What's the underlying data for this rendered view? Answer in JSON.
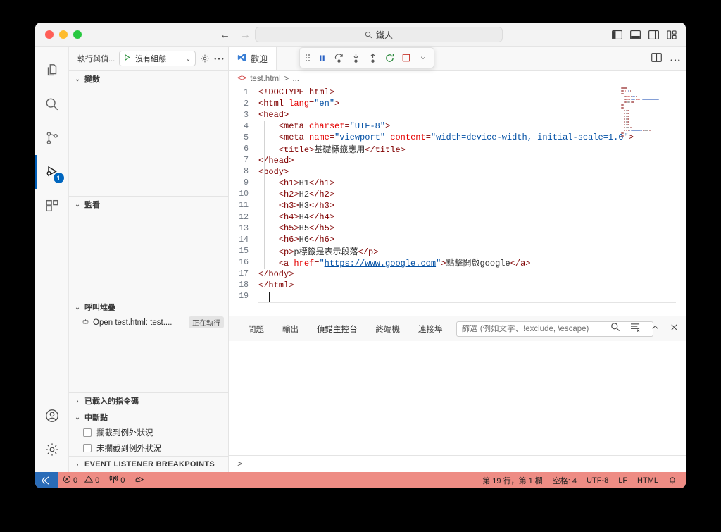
{
  "window": {
    "traffic_lights": [
      "close",
      "minimize",
      "maximize"
    ],
    "command_center_value": "鐵人",
    "nav_back": "←",
    "nav_forward": "→"
  },
  "activitybar": {
    "items": [
      {
        "name": "explorer",
        "icon": "files-icon",
        "active": false
      },
      {
        "name": "search",
        "icon": "search-icon",
        "active": false
      },
      {
        "name": "source-control",
        "icon": "source-control-icon",
        "active": false
      },
      {
        "name": "run-and-debug",
        "icon": "run-debug-icon",
        "active": true,
        "badge": "1"
      },
      {
        "name": "extensions",
        "icon": "extensions-icon",
        "active": false
      }
    ],
    "bottom": [
      {
        "name": "account",
        "icon": "account-icon"
      },
      {
        "name": "manage",
        "icon": "gear-icon"
      }
    ]
  },
  "sidebar": {
    "title": "執行與偵...",
    "launch_config": "沒有組態",
    "start_debug_label": "▷",
    "panes": [
      {
        "id": "variables",
        "label": "變數",
        "expanded": true
      },
      {
        "id": "watch",
        "label": "監看",
        "expanded": true
      },
      {
        "id": "callstack",
        "label": "呼叫堆疊",
        "expanded": true
      },
      {
        "id": "loaded_scripts",
        "label": "已載入的指令碼",
        "expanded": false
      },
      {
        "id": "breakpoints",
        "label": "中斷點",
        "expanded": true
      },
      {
        "id": "event_listener_breakpoints",
        "label": "EVENT LISTENER BREAKPOINTS",
        "expanded": false
      }
    ],
    "callstack_rows": [
      {
        "label": "Open test.html: test....",
        "state": "正在執行"
      }
    ],
    "breakpoint_rows": [
      {
        "label": "攔截到例外狀況",
        "checked": false
      },
      {
        "label": "未攔截到例外狀況",
        "checked": false
      }
    ]
  },
  "editor": {
    "tab": {
      "label": "歡迎",
      "icon": "vscode-logo-icon"
    },
    "breadcrumb": {
      "file": "test.html",
      "separator": ">",
      "tail": "..."
    },
    "debug_toolbar": [
      {
        "name": "drag-handle",
        "icon": "grip-icon"
      },
      {
        "name": "pause",
        "icon": "pause-icon"
      },
      {
        "name": "step-over",
        "icon": "step-over-icon"
      },
      {
        "name": "step-into",
        "icon": "step-into-icon"
      },
      {
        "name": "step-out",
        "icon": "step-out-icon"
      },
      {
        "name": "restart",
        "icon": "restart-icon"
      },
      {
        "name": "stop",
        "icon": "stop-icon"
      },
      {
        "name": "more",
        "icon": "chevron-down-icon"
      }
    ],
    "lines": [
      {
        "n": "1",
        "indent": 0,
        "tokens": [
          {
            "t": "tag",
            "v": "<!DOCTYPE html>"
          }
        ]
      },
      {
        "n": "2",
        "indent": 0,
        "tokens": [
          {
            "t": "tag",
            "v": "<html "
          },
          {
            "t": "attr",
            "v": "lang"
          },
          {
            "t": "tag",
            "v": "="
          },
          {
            "t": "str",
            "v": "\"en\""
          },
          {
            "t": "tag",
            "v": ">"
          }
        ]
      },
      {
        "n": "3",
        "indent": 0,
        "tokens": [
          {
            "t": "tag",
            "v": "<head>"
          }
        ]
      },
      {
        "n": "4",
        "indent": 1,
        "tokens": [
          {
            "t": "tag",
            "v": "<meta "
          },
          {
            "t": "attr",
            "v": "charset"
          },
          {
            "t": "tag",
            "v": "="
          },
          {
            "t": "str",
            "v": "\"UTF-8\""
          },
          {
            "t": "tag",
            "v": ">"
          }
        ]
      },
      {
        "n": "5",
        "indent": 1,
        "tokens": [
          {
            "t": "tag",
            "v": "<meta "
          },
          {
            "t": "attr",
            "v": "name"
          },
          {
            "t": "tag",
            "v": "="
          },
          {
            "t": "str",
            "v": "\"viewport\""
          },
          {
            "t": "tag",
            "v": " "
          },
          {
            "t": "attr",
            "v": "content"
          },
          {
            "t": "tag",
            "v": "="
          },
          {
            "t": "str",
            "v": "\"width=device-width, initial-scale=1.0\""
          },
          {
            "t": "tag",
            "v": ">"
          }
        ]
      },
      {
        "n": "6",
        "indent": 1,
        "tokens": [
          {
            "t": "tag",
            "v": "<title>"
          },
          {
            "t": "txt",
            "v": "基礎標籤應用"
          },
          {
            "t": "tag",
            "v": "</title>"
          }
        ]
      },
      {
        "n": "7",
        "indent": 0,
        "tokens": [
          {
            "t": "tag",
            "v": "</head>"
          }
        ]
      },
      {
        "n": "8",
        "indent": 0,
        "tokens": [
          {
            "t": "tag",
            "v": "<body>"
          }
        ]
      },
      {
        "n": "9",
        "indent": 1,
        "tokens": [
          {
            "t": "tag",
            "v": "<h1>"
          },
          {
            "t": "txt",
            "v": "H1"
          },
          {
            "t": "tag",
            "v": "</h1>"
          }
        ]
      },
      {
        "n": "10",
        "indent": 1,
        "tokens": [
          {
            "t": "tag",
            "v": "<h2>"
          },
          {
            "t": "txt",
            "v": "H2"
          },
          {
            "t": "tag",
            "v": "</h2>"
          }
        ]
      },
      {
        "n": "11",
        "indent": 1,
        "tokens": [
          {
            "t": "tag",
            "v": "<h3>"
          },
          {
            "t": "txt",
            "v": "H3"
          },
          {
            "t": "tag",
            "v": "</h3>"
          }
        ]
      },
      {
        "n": "12",
        "indent": 1,
        "tokens": [
          {
            "t": "tag",
            "v": "<h4>"
          },
          {
            "t": "txt",
            "v": "H4"
          },
          {
            "t": "tag",
            "v": "</h4>"
          }
        ]
      },
      {
        "n": "13",
        "indent": 1,
        "tokens": [
          {
            "t": "tag",
            "v": "<h5>"
          },
          {
            "t": "txt",
            "v": "H5"
          },
          {
            "t": "tag",
            "v": "</h5>"
          }
        ]
      },
      {
        "n": "14",
        "indent": 1,
        "tokens": [
          {
            "t": "tag",
            "v": "<h6>"
          },
          {
            "t": "txt",
            "v": "H6"
          },
          {
            "t": "tag",
            "v": "</h6>"
          }
        ]
      },
      {
        "n": "15",
        "indent": 1,
        "tokens": [
          {
            "t": "tag",
            "v": "<p>"
          },
          {
            "t": "txt",
            "v": "p標籤是表示段落"
          },
          {
            "t": "tag",
            "v": "</p>"
          }
        ]
      },
      {
        "n": "16",
        "indent": 1,
        "tokens": [
          {
            "t": "tag",
            "v": "<a "
          },
          {
            "t": "attr",
            "v": "href"
          },
          {
            "t": "tag",
            "v": "="
          },
          {
            "t": "str",
            "v": "\""
          },
          {
            "t": "link",
            "v": "https://www.google.com"
          },
          {
            "t": "str",
            "v": "\""
          },
          {
            "t": "tag",
            "v": ">"
          },
          {
            "t": "txt",
            "v": "點擊開啟google"
          },
          {
            "t": "tag",
            "v": "</a>"
          }
        ]
      },
      {
        "n": "17",
        "indent": 0,
        "tokens": [
          {
            "t": "tag",
            "v": "</body>"
          }
        ]
      },
      {
        "n": "18",
        "indent": 0,
        "tokens": [
          {
            "t": "tag",
            "v": "</html>"
          }
        ]
      },
      {
        "n": "19",
        "indent": 0,
        "tokens": []
      }
    ],
    "actions": [
      {
        "name": "split-editor",
        "icon": "split-editor-icon"
      },
      {
        "name": "more-actions",
        "icon": "ellipsis-icon"
      }
    ]
  },
  "panel": {
    "tabs": [
      {
        "label": "問題",
        "active": false
      },
      {
        "label": "輸出",
        "active": false
      },
      {
        "label": "偵錯主控台",
        "active": true
      },
      {
        "label": "終端機",
        "active": false
      },
      {
        "label": "連接埠",
        "active": false
      }
    ],
    "filter_placeholder": "篩選 (例如文字、!exclude, \\escape)",
    "filter_value": "",
    "actions": [
      {
        "name": "find",
        "icon": "search-icon"
      },
      {
        "name": "clear-console",
        "icon": "clear-icon"
      },
      {
        "name": "maximize-panel",
        "icon": "chevron-up-icon"
      },
      {
        "name": "close-panel",
        "icon": "close-icon"
      }
    ],
    "console_prompt": ">"
  },
  "statusbar": {
    "remote_icon": "remote-indicator-icon",
    "errors": "0",
    "warnings": "0",
    "ports": "0",
    "debug_icon": "debug-alt-icon",
    "cursor_position": "第 19 行，第 1 欄",
    "indentation": "空格: 4",
    "encoding": "UTF-8",
    "eol": "LF",
    "language": "HTML",
    "bell_icon": "bell-icon",
    "background": "#ee8c84"
  },
  "colors": {
    "accent": "#005fb8",
    "debug_statusbar": "#ee8c84",
    "tag": "#800000",
    "attr": "#e50000",
    "string": "#0451a5"
  }
}
